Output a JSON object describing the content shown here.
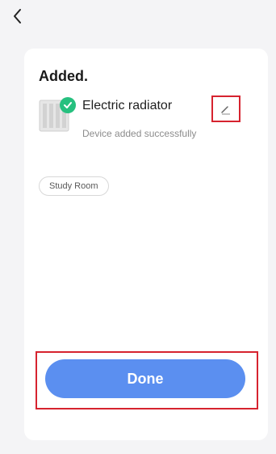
{
  "header": {
    "back_icon": "chevron-left-icon"
  },
  "card": {
    "title": "Added.",
    "device": {
      "name": "Electric radiator",
      "status": "Device added successfully",
      "thumb_icon": "radiator-icon",
      "badge_icon": "checkmark-icon",
      "edit_icon": "pencil-icon"
    },
    "room_chip": "Study Room",
    "done_label": "Done"
  },
  "colors": {
    "accent": "#5b8ff0",
    "success": "#26c07f",
    "highlight": "#d6232f",
    "background": "#f4f4f6"
  }
}
